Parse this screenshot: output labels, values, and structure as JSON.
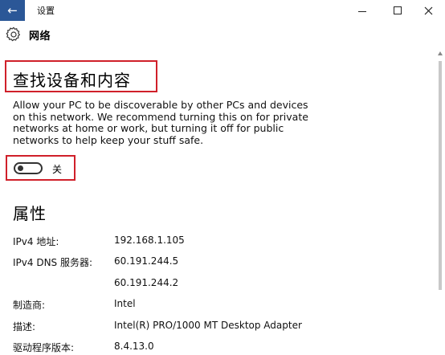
{
  "window": {
    "title": "设置",
    "back_icon": "arrow-left-icon"
  },
  "header": {
    "title": "网络",
    "icon": "gear-icon"
  },
  "discovery": {
    "title": "查找设备和内容",
    "lines": [
      "Allow your PC to be discoverable by other PCs and devices",
      "on this network. We recommend turning this on for private",
      "networks at home or work, but turning it off for public",
      "networks to help keep your stuff safe."
    ],
    "toggle_state": "关",
    "toggle_on": false
  },
  "properties": {
    "title": "属性",
    "rows": [
      {
        "key": "IPv4 地址:",
        "value": "192.168.1.105"
      },
      {
        "key": "IPv4 DNS 服务器:",
        "value": "60.191.244.5"
      },
      {
        "key": "",
        "value": "60.191.244.2"
      },
      {
        "key": "制造商:",
        "value": "Intel"
      },
      {
        "key": "描述:",
        "value": "Intel(R) PRO/1000 MT Desktop Adapter"
      },
      {
        "key": "驱动程序版本:",
        "value": "8.4.13.0"
      }
    ]
  },
  "colors": {
    "accent": "#2b5797",
    "highlight_border": "#d0202a"
  }
}
